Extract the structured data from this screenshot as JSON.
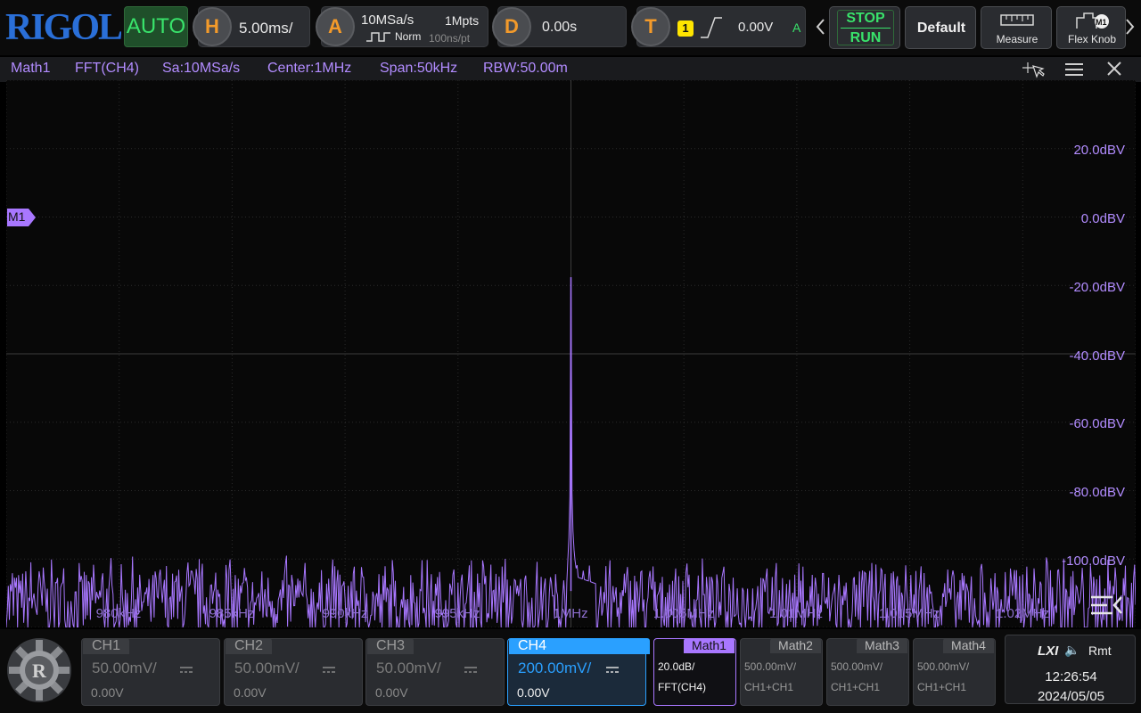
{
  "brand": "RIGOL",
  "top": {
    "mode": "AUTO",
    "horizontal": {
      "badge": "H",
      "value": "5.00ms/"
    },
    "acquire": {
      "badge": "A",
      "sample_rate": "10MSa/s",
      "depth": "1Mpts",
      "mode": "Norm",
      "resolution": "100ns/pt"
    },
    "delay": {
      "badge": "D",
      "value": "0.00s"
    },
    "trigger": {
      "badge": "T",
      "source": "1",
      "level": "0.00V",
      "status": "A"
    },
    "stop_label": "STOP",
    "run_label": "RUN",
    "default_label": "Default",
    "measure_label": "Measure",
    "flexknob_label": "Flex Knob",
    "flexknob_badge": "M1"
  },
  "math_header": {
    "name": "Math1",
    "source": "FFT(CH4)",
    "sample": "Sa:10MSa/s",
    "center": "Center:1MHz",
    "span": "Span:50kHz",
    "rbw": "RBW:50.00m"
  },
  "plot": {
    "marker": "M1",
    "y_labels": [
      "20.0dBV",
      "0.0dBV",
      "-20.0dBV",
      "-40.0dBV",
      "-60.0dBV",
      "-80.0dBV",
      "-100.0dBV"
    ],
    "x_labels": [
      "980kHz",
      "985kHz",
      "990kHz",
      "995kHz",
      "1MHz",
      "1.005MHz",
      "1.01MHz",
      "1.015MHz",
      "1.02MHz"
    ]
  },
  "chart_data": {
    "type": "line",
    "xlabel": "",
    "ylabel": "",
    "x_unit": "Hz",
    "y_unit": "dBV",
    "xlim": [
      975000,
      1025000
    ],
    "ylim": [
      -110,
      40
    ],
    "series": [
      {
        "name": "FFT(CH4)",
        "x": [
          975000,
          995000,
          998000,
          999800,
          999950,
          1000000,
          1000050,
          1000200,
          1002000,
          1005000,
          1025000
        ],
        "values": [
          -100,
          -100,
          -100,
          -100,
          -80,
          -14,
          -79,
          -96,
          -100,
          -100,
          -100
        ]
      }
    ],
    "noise_floor": -100,
    "peak": {
      "x": 1000000,
      "y": -14
    },
    "grid": true,
    "color": "#a877ff"
  },
  "channels": [
    {
      "name": "CH1",
      "scale": "50.00mV/",
      "offset": "0.00V",
      "active": false
    },
    {
      "name": "CH2",
      "scale": "50.00mV/",
      "offset": "0.00V",
      "active": false
    },
    {
      "name": "CH3",
      "scale": "50.00mV/",
      "offset": "0.00V",
      "active": false
    },
    {
      "name": "CH4",
      "scale": "200.00mV/",
      "offset": "0.00V",
      "active": true
    }
  ],
  "maths": [
    {
      "name": "Math1",
      "scale": "20.0dB/",
      "source": "FFT(CH4)",
      "active": true
    },
    {
      "name": "Math2",
      "scale": "500.00mV/",
      "source": "CH1+CH1",
      "active": false
    },
    {
      "name": "Math3",
      "scale": "500.00mV/",
      "source": "CH1+CH1",
      "active": false
    },
    {
      "name": "Math4",
      "scale": "500.00mV/",
      "source": "CH1+CH1",
      "active": false
    }
  ],
  "status": {
    "lxi": "LXI",
    "audio": "🔈",
    "remote": "Rmt",
    "time": "12:26:54",
    "date": "2024/05/05"
  },
  "colors": {
    "accent": "#a877ff",
    "run": "#39e36b",
    "ch4": "#2aa0ff",
    "badge": "#f39a2a",
    "trigger_badge": "#ffe500"
  }
}
